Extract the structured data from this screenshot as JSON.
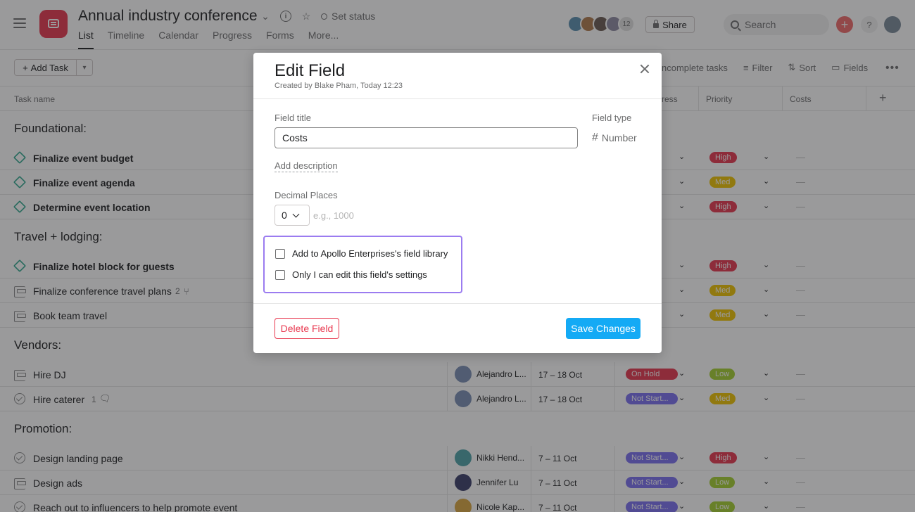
{
  "header": {
    "project_title": "Annual industry conference",
    "set_status": "Set status",
    "tabs": [
      "List",
      "Timeline",
      "Calendar",
      "Progress",
      "Forms",
      "More..."
    ],
    "member_count": "12",
    "share": "Share",
    "search_placeholder": "Search"
  },
  "toolbar": {
    "add_task": "Add Task",
    "incomplete": "ncomplete tasks",
    "filter": "Filter",
    "sort": "Sort",
    "fields": "Fields"
  },
  "columns": {
    "task_name": "Task name",
    "progress": "ress",
    "priority": "Priority",
    "costs": "Costs"
  },
  "sections": [
    {
      "name": "Foundational:",
      "tasks": [
        {
          "name": "Finalize event budget",
          "priority": "High"
        },
        {
          "name": "Finalize event agenda",
          "priority": "Med"
        },
        {
          "name": "Determine event location",
          "priority": "High"
        }
      ]
    },
    {
      "name": "Travel + lodging:",
      "tasks": [
        {
          "name": "Finalize hotel block for guests",
          "priority": "High"
        },
        {
          "name": "Finalize conference travel plans",
          "subtasks": "2",
          "priority": "Med"
        },
        {
          "name": "Book team travel",
          "priority": "Med"
        }
      ]
    },
    {
      "name": "Vendors:",
      "tasks": [
        {
          "name": "Hire DJ",
          "assignee": "Alejandro L...",
          "date": "17 – 18 Oct",
          "status": "On Hold",
          "priority": "Low"
        },
        {
          "name": "Hire caterer",
          "comments": "1",
          "assignee": "Alejandro L...",
          "date": "17 – 18 Oct",
          "status": "Not Start...",
          "priority": "Med"
        }
      ]
    },
    {
      "name": "Promotion:",
      "tasks": [
        {
          "name": "Design landing page",
          "assignee": "Nikki Hend...",
          "date": "7 – 11 Oct",
          "status": "Not Start...",
          "priority": "High"
        },
        {
          "name": "Design ads",
          "assignee": "Jennifer Lu",
          "date": "7 – 11 Oct",
          "status": "Not Start...",
          "priority": "Low"
        },
        {
          "name": "Reach out to influencers to help promote event",
          "assignee": "Nicole Kap...",
          "date": "7 – 11 Oct",
          "status": "Not Start...",
          "priority": "Low"
        }
      ]
    }
  ],
  "empty_cost": "—",
  "modal": {
    "title": "Edit Field",
    "subtitle": "Created by Blake Pham, Today 12:23",
    "field_title_label": "Field title",
    "field_title_value": "Costs",
    "field_type_label": "Field type",
    "field_type_value": "Number",
    "add_description": "Add description",
    "decimal_label": "Decimal Places",
    "decimal_value": "0",
    "decimal_placeholder": "e.g., 1000",
    "option_library": "Add to Apollo Enterprises's field library",
    "option_only_me": "Only I can edit this field's settings",
    "delete": "Delete Field",
    "save": "Save Changes"
  },
  "colors": {
    "high": "#e8384f",
    "med": "#eec300",
    "low": "#a4cf30",
    "on_hold": "#e8384f",
    "not_started": "#7a6ff0",
    "save": "#14aaf5",
    "highlight": "#9b7cf0"
  }
}
